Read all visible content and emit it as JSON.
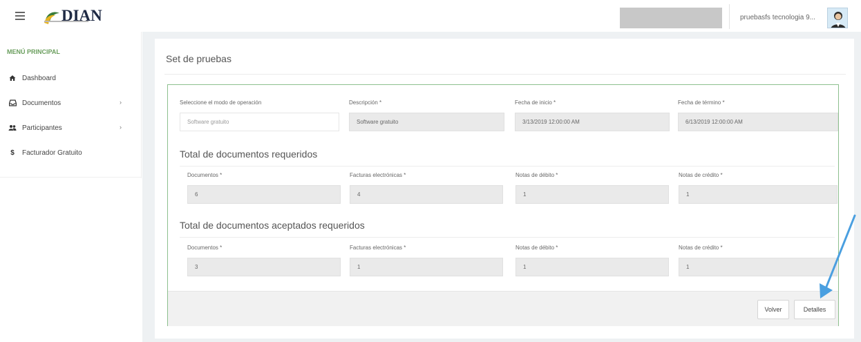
{
  "header": {
    "logo_text": "DIAN",
    "username": "pruebasfs tecnologia 9..."
  },
  "sidebar": {
    "title": "MENÚ PRINCIPAL",
    "items": [
      {
        "label": "Dashboard",
        "icon": "home-icon"
      },
      {
        "label": "Documentos",
        "icon": "inbox-icon",
        "has_submenu": true
      },
      {
        "label": "Participantes",
        "icon": "users-icon",
        "has_submenu": true
      },
      {
        "label": "Facturador Gratuito",
        "icon": "dollar-icon"
      }
    ],
    "chevron": "›"
  },
  "main": {
    "title": "Set de pruebas",
    "mode": {
      "label": "Seleccione el modo de operación",
      "placeholder": "Software gratuito"
    },
    "description": {
      "label": "Descripción *",
      "value": "Software gratuito"
    },
    "start_date": {
      "label": "Fecha de inicio *",
      "value": "3/13/2019 12:00:00 AM"
    },
    "end_date": {
      "label": "Fecha de término *",
      "value": "6/13/2019 12:00:00 AM"
    },
    "required": {
      "title": "Total de documentos requeridos",
      "fields": [
        {
          "label": "Documentos *",
          "value": "6"
        },
        {
          "label": "Facturas electrónicas *",
          "value": "4"
        },
        {
          "label": "Notas de débito *",
          "value": "1"
        },
        {
          "label": "Notas de crédito *",
          "value": "1"
        }
      ]
    },
    "accepted": {
      "title": "Total de documentos aceptados requeridos",
      "fields": [
        {
          "label": "Documentos *",
          "value": "3"
        },
        {
          "label": "Facturas electrónicas *",
          "value": "1"
        },
        {
          "label": "Notas de débito *",
          "value": "1"
        },
        {
          "label": "Notas de crédito *",
          "value": "1"
        }
      ]
    },
    "buttons": {
      "back": "Volver",
      "details": "Detalles"
    }
  },
  "colors": {
    "accent_green": "#6a9e5d",
    "panel_border": "#8cbf8d",
    "annotation_arrow": "#4a9fe0"
  }
}
